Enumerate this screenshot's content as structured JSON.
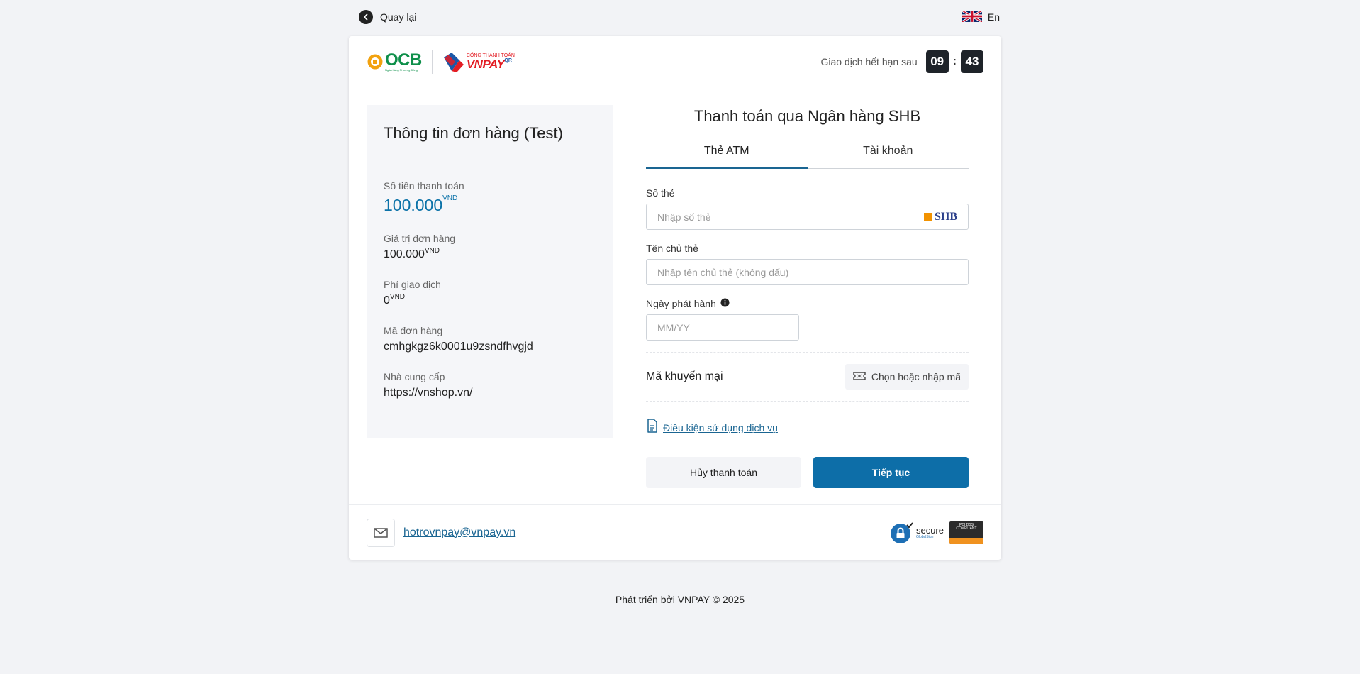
{
  "topbar": {
    "back_label": "Quay lại",
    "lang_label": "En"
  },
  "header": {
    "ocb_brand": "OCB",
    "ocb_tagline": "Ngân hàng Phương Đông",
    "vnpay_caption": "CỔNG THANH TOÁN",
    "vnpay_brand": "VNPAY",
    "vnpay_qr": "QR",
    "expire_label": "Giao dịch hết hạn sau",
    "timer_minutes": "09",
    "timer_separator": ":",
    "timer_seconds": "43"
  },
  "order": {
    "title": "Thông tin đơn hàng (Test)",
    "amount_label": "Số tiền thanh toán",
    "amount_value": "100.000",
    "currency": "VND",
    "order_value_label": "Giá trị đơn hàng",
    "order_value": "100.000",
    "fee_label": "Phí giao dịch",
    "fee_value": "0",
    "order_id_label": "Mã đơn hàng",
    "order_id": "cmhgkgz6k0001u9zsndfhvgjd",
    "provider_label": "Nhà cung cấp",
    "provider": "https://vnshop.vn/"
  },
  "payment": {
    "title": "Thanh toán qua Ngân hàng SHB",
    "tabs": [
      {
        "label": "Thẻ ATM",
        "active": true
      },
      {
        "label": "Tài khoản",
        "active": false
      }
    ],
    "card_number_label": "Số thẻ",
    "card_number_placeholder": "Nhập số thẻ",
    "bank_code": "SHB",
    "holder_label": "Tên chủ thẻ",
    "holder_placeholder": "Nhập tên chủ thẻ (không dấu)",
    "issue_date_label": "Ngày phát hành",
    "issue_date_placeholder": "MM/YY",
    "promo_label": "Mã khuyến mại",
    "promo_button": "Chọn hoặc nhập mã",
    "terms_link": "Điều kiện sử dụng dịch vụ",
    "cancel_button": "Hủy thanh toán",
    "continue_button": "Tiếp tục"
  },
  "footer": {
    "support_email": "hotrovnpay@vnpay.vn",
    "secure_label": "secure",
    "secure_sub": "GlobalSign",
    "pci_label": "PCI DSS COMPLIANT"
  },
  "copyright": "Phát triển bởi VNPAY © 2025",
  "colors": {
    "primary": "#0d6ea8",
    "amount": "#0b72a8",
    "ocb_green": "#0e8f4a",
    "ocb_gold": "#f2a20f",
    "vnpay_red": "#e31d24",
    "vnpay_blue": "#1b58a8"
  }
}
